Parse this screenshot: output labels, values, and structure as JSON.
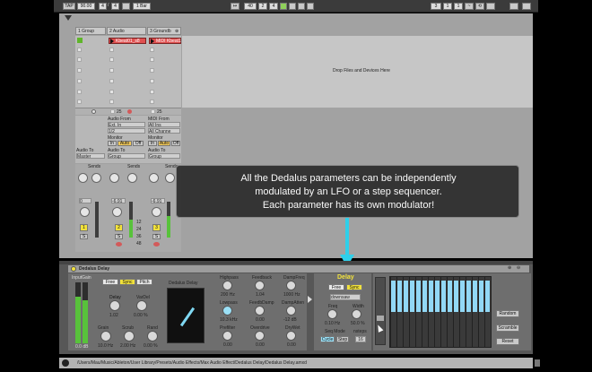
{
  "transport": {
    "tap": "TAP",
    "tempo": "90.00",
    "sig_num": "4",
    "sig_den": "4",
    "quant": "1 Bar",
    "pos_a": "40",
    "pos_b": "2",
    "pos_c": "4",
    "loop_a": "3",
    "loop_b": "1",
    "loop_c": "1"
  },
  "tracks": [
    {
      "name": "1 Group",
      "num": "1",
      "io_label": "Audio To",
      "route": "Master",
      "sends_label": "Sends",
      "vol": "0",
      "pan": "C"
    },
    {
      "name": "2 Audio",
      "num": "2",
      "clip": "Kbeat01_s8",
      "in_label": "Audio From",
      "in_type": "Ext. In",
      "in_chan": "1/2",
      "monitor_label": "Monitor",
      "mon_in": "In",
      "mon_auto": "Auto",
      "mon_off": "Off",
      "out_label": "Audio To",
      "route": "Group",
      "sends_label": "Sends",
      "vol": "-6.91",
      "pan": "C"
    },
    {
      "name": "3 Groundb",
      "num": "3",
      "clip": "MIDI Kbeat1",
      "in_label": "MIDI From",
      "in_type": "All Ins",
      "in_chan": "All Channe",
      "monitor_label": "Monitor",
      "mon_in": "In",
      "mon_auto": "Auto",
      "mon_off": "Off",
      "out_label": "Audio To",
      "route": "Group",
      "sends_label": "Sends",
      "vol": "-6.91",
      "pan": "C"
    }
  ],
  "scale_nums": [
    "12",
    "24",
    "36",
    "48"
  ],
  "group_num": "25",
  "drop_text": "Drop Files and Devices Here",
  "tooltip": {
    "line1": "All the Dedalus parameters can be independently",
    "line2": "modulated by an LFO or a step sequencer.",
    "line3": "Each parameter has its own modulator!"
  },
  "device": {
    "title": "Dedalus Delay",
    "inputgain_label": "InputGain",
    "inputgain_value": "0.0 dB",
    "free": "Free",
    "sync": "Sync",
    "pitch": "Pitch",
    "display_label": "Dedalus Delay",
    "delay_label": "Delay",
    "delay_value": "1.02",
    "vardel_label": "VarDel",
    "vardel_value": "0.00 %",
    "grain_label": "Grain",
    "grain_value": "10.0 Hz",
    "scrub_label": "Scrub",
    "scrub_value": "2.00 Hz",
    "rand_label": "Rand",
    "rand_value": "0.00 %",
    "highpass_label": "Highpass",
    "highpass_value": "200 Hz",
    "lowpass_label": "Lowpass",
    "lowpass_value": "10.3 kHz",
    "prefilter_label": "Prefilter",
    "prefilter_value": "0.00",
    "feedback_label": "Feedback",
    "feedback_value": "1.04",
    "feedbdamp_label": "FeedbDamp",
    "feedbdamp_value": "0.00",
    "overdrive_label": "Overdrive",
    "overdrive_value": "0.00",
    "dampfreq_label": "DampFreq",
    "dampfreq_value": "1000 Hz",
    "dampatten_label": "DampAtten",
    "dampatten_value": "-12 dB",
    "drywet_label": "DryWet",
    "drywet_value": "0.00"
  },
  "modulator": {
    "title": "Delay",
    "free": "Free",
    "sync": "Sync",
    "direction": "downsaw",
    "freq_label": "Freq",
    "freq_value": "0.10 Hz",
    "width_label": "Width",
    "width_value": "50.0 %",
    "seqmode_label": "Seq Mode",
    "cycle": "Cycle",
    "step": "Step",
    "nsteps_label": "nsteps",
    "nsteps_value": "16",
    "random": "Random",
    "scramble": "Scramble",
    "reset": "Reset"
  },
  "step_values": [
    0.9,
    0.9,
    0.9,
    0.9,
    0.9,
    0.9,
    0.9,
    0.9,
    0.9,
    0.9,
    0.9,
    0.9,
    0.9,
    0.9,
    0.9,
    0.9
  ],
  "status_path": "/Users/Mau/Music/Ableton/User Library/Presets/Audio Effects/Max Audio Effect/Dedalus Delay/Dedalus Delay.amxd",
  "colors": {
    "accent": "#2fd0ea",
    "clip_red": "#e05050",
    "led_yellow": "#f2e23c",
    "step_blue": "#92d8f6"
  }
}
